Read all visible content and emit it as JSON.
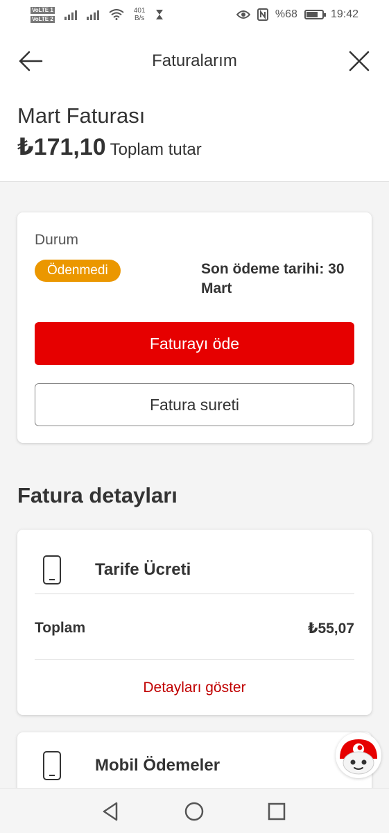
{
  "status_bar": {
    "volte1": "VoLTE 1",
    "volte2": "VoLTE 2",
    "net_speed_value": "401",
    "net_speed_unit": "B/s",
    "battery_text": "%68",
    "time": "19:42",
    "battery_level": 0.68
  },
  "header": {
    "title": "Faturalarım"
  },
  "summary": {
    "bill_name": "Mart Faturası",
    "amount": "₺171,10",
    "amount_label": "Toplam tutar"
  },
  "status_card": {
    "label": "Durum",
    "badge": "Ödenmedi",
    "due_date": "Son ödeme tarihi: 30 Mart",
    "pay_button": "Faturayı öde",
    "copy_button": "Fatura sureti"
  },
  "details": {
    "section_title": "Fatura detayları",
    "items": [
      {
        "title": "Tarife Ücreti",
        "total_label": "Toplam",
        "total_value": "₺55,07",
        "show_details": "Detayları göster"
      },
      {
        "title": "Mobil Ödemeler"
      }
    ]
  },
  "colors": {
    "primary_red": "#e60000",
    "badge_orange": "#eb9700",
    "link_red": "#c00000"
  },
  "icons": {
    "back": "arrow-left-icon",
    "close": "close-icon",
    "phone": "mobile-phone-icon",
    "assistant": "tobi-assistant-icon",
    "nav_back": "triangle-back-icon",
    "nav_home": "circle-home-icon",
    "nav_recents": "square-recents-icon"
  }
}
